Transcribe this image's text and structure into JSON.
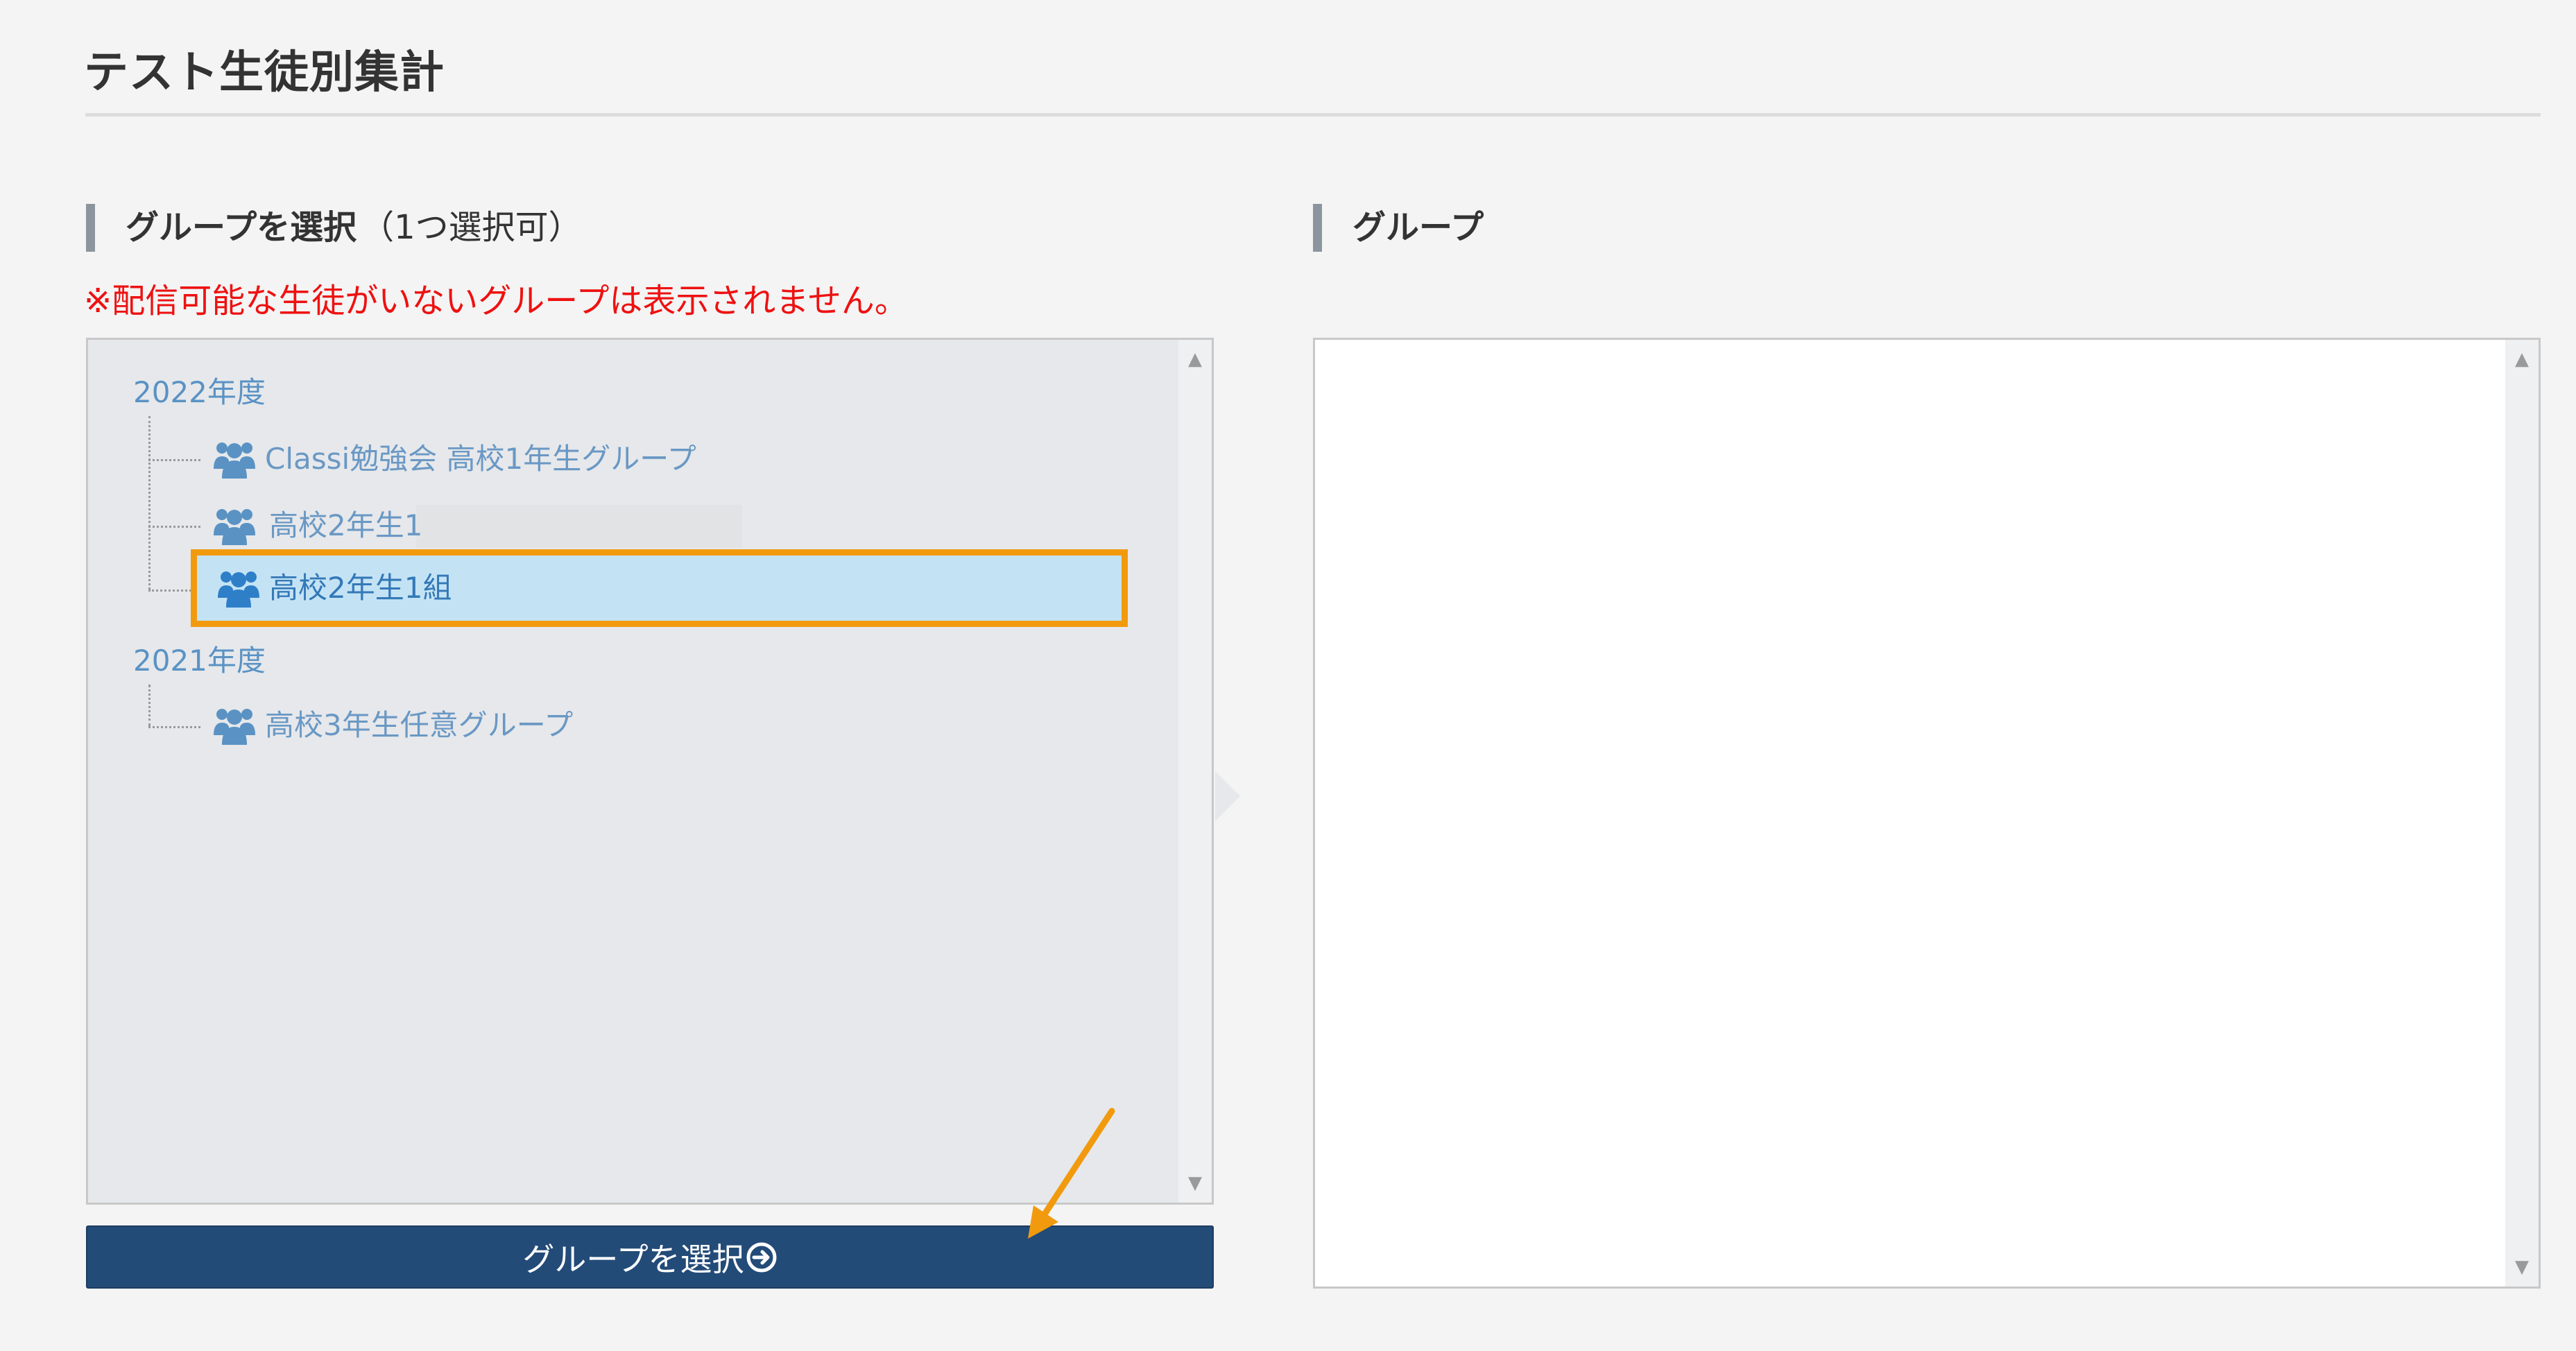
{
  "page": {
    "title": "テスト生徒別集計"
  },
  "left_section": {
    "heading": "グループを選択",
    "heading_sub": "（1つ選択可）",
    "notice": "※配信可能な生徒がいないグループは表示されません。"
  },
  "right_section": {
    "heading": "グループ"
  },
  "tree": {
    "years": [
      {
        "label": "2022年度",
        "groups": [
          {
            "label": "Classi勉強会 高校1年生グループ",
            "icon": "group-icon",
            "selected": false
          },
          {
            "label": "高校2年生1",
            "icon": "group-icon",
            "selected": false
          },
          {
            "label": "高校2年生1組",
            "icon": "group-icon",
            "selected": true
          }
        ]
      },
      {
        "label": "2021年度",
        "groups": [
          {
            "label": "高校3年生任意グループ",
            "icon": "group-icon",
            "selected": false
          }
        ]
      }
    ]
  },
  "buttons": {
    "select_group": "グループを選択"
  },
  "icons": {
    "scroll_up": "▲",
    "scroll_down": "▼",
    "button_icon": "circle-arrow-right-icon"
  },
  "colors": {
    "primary_button": "#234b78",
    "highlight_border": "#f29a0e",
    "selected_background": "#c3e3f5",
    "tree_text": "#6a98c4",
    "notice_text": "#ee1111"
  }
}
